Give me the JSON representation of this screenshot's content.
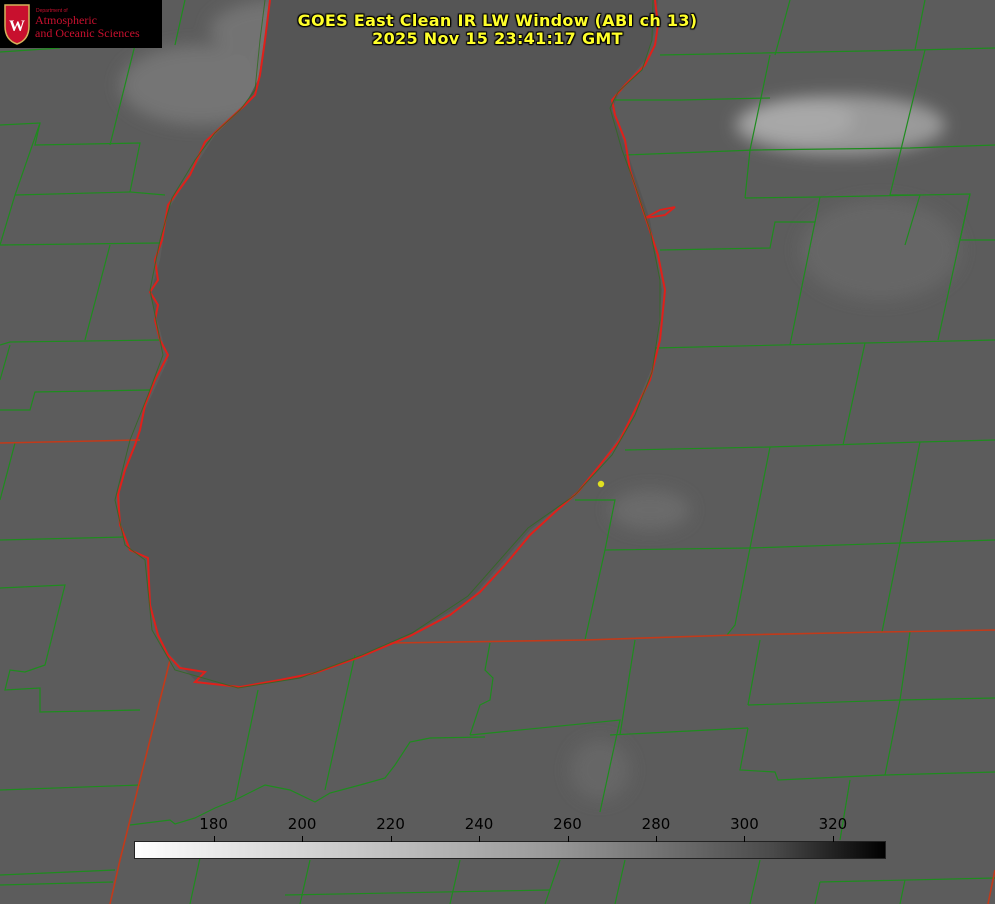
{
  "title": {
    "line1": "GOES East Clean IR LW Window (ABI ch 13)",
    "line2": "2025 Nov 15 23:41:17 GMT"
  },
  "logo": {
    "department": "Department of",
    "line1": "Atmospheric",
    "line2": "and Oceanic Sciences",
    "emblem_letter": "W"
  },
  "colorbar": {
    "tick_labels": [
      "180",
      "200",
      "220",
      "240",
      "260",
      "280",
      "300",
      "320"
    ],
    "range": [
      162,
      332
    ],
    "scale": "white (cold) to black (warm)"
  },
  "colors": {
    "title": "#ffff2a",
    "state_border": "#d2281e",
    "county_lines": "#1e8c1e",
    "shoreline": "#e0201a",
    "marker": "#e0e020"
  }
}
